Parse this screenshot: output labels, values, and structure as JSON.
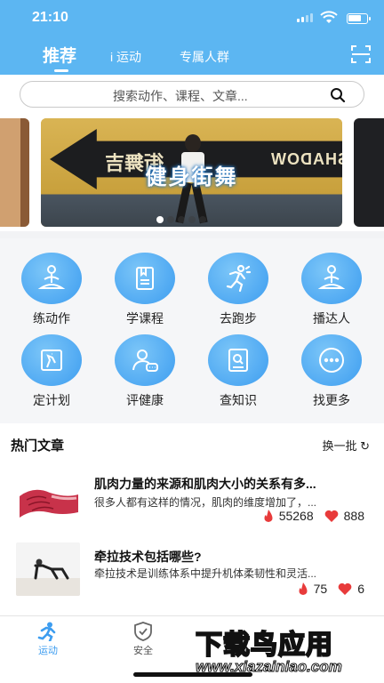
{
  "status_bar": {
    "time": "21:10"
  },
  "header": {
    "tabs": [
      {
        "label": "推荐",
        "active": true
      },
      {
        "label": "运动",
        "active": false
      },
      {
        "label": "专属人群",
        "active": false
      }
    ],
    "scan_icon": "scan-icon"
  },
  "search": {
    "placeholder": "搜索动作、课程、文章..."
  },
  "banner": {
    "caption": "健身街舞",
    "sign_text": "街舞吉",
    "sign_text_right": "SHADOW",
    "dots": 5,
    "active_dot": 1
  },
  "features": [
    {
      "label": "练动作",
      "icon": "meditation-icon"
    },
    {
      "label": "学课程",
      "icon": "course-book-icon"
    },
    {
      "label": "去跑步",
      "icon": "running-icon"
    },
    {
      "label": "播达人",
      "icon": "meditation-icon"
    },
    {
      "label": "定计划",
      "icon": "plan-icon"
    },
    {
      "label": "评健康",
      "icon": "health-chat-icon"
    },
    {
      "label": "查知识",
      "icon": "knowledge-book-icon"
    },
    {
      "label": "找更多",
      "icon": "more-icon"
    }
  ],
  "articles": {
    "title": "热门文章",
    "refresh_label": "换一批",
    "items": [
      {
        "title": "肌肉力量的来源和肌肉大小的关系有多...",
        "summary": "很多人都有这样的情况，肌肉的维度增加了，...",
        "views": "55268",
        "likes": "888"
      },
      {
        "title": "牵拉技术包括哪些?",
        "summary": "牵拉技术是训练体系中提升机体柔韧性和灵活...",
        "views": "75",
        "likes": "6"
      }
    ]
  },
  "bottom_nav": [
    {
      "label": "运动",
      "active": true
    },
    {
      "label": "安全",
      "active": false
    }
  ],
  "watermark": {
    "line1": "下载鸟应用",
    "line2": "www.xiazainiao.com"
  },
  "colors": {
    "primary": "#5cb6f2",
    "accent_red": "#e83b3b"
  }
}
